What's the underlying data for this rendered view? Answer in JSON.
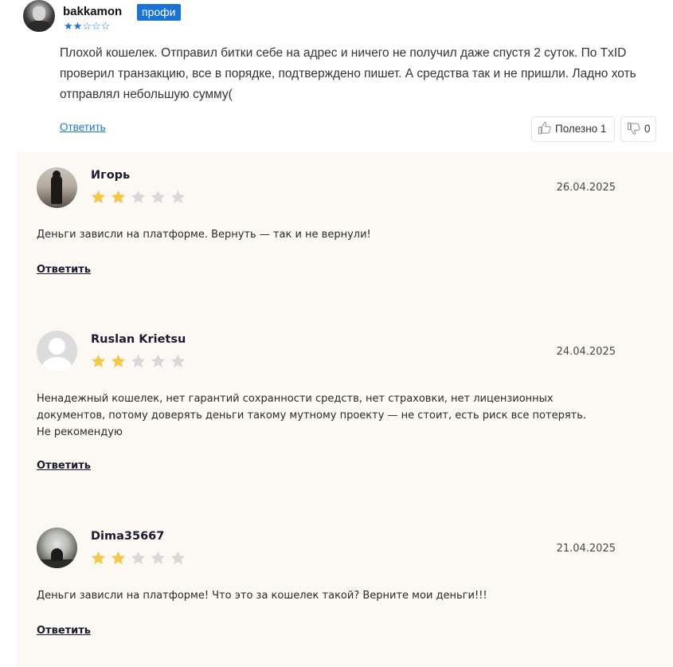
{
  "top_review": {
    "username": "bakkamon",
    "badge": "профи",
    "stars_filled": 2,
    "stars_total": 5,
    "text": "Плохой кошелек. Отправил битки себе на адрес и ничего не получил даже спустя 2 суток. По TxID проверил транзакцию, все в порядке, подтверждено пишет. А средства так и не пришли. Ладно хоть отправлял небольшую сумму(",
    "reply_label": "Ответить",
    "like_label": "Полезно 1",
    "dislike_count": "0"
  },
  "reviews": [
    {
      "name": "Игорь",
      "date": "26.04.2025",
      "rating": 2,
      "text": "Деньги зависли на платформе. Вернуть — так и не вернули!",
      "reply_label": "Ответить"
    },
    {
      "name": "Ruslan Krietsu",
      "date": "24.04.2025",
      "rating": 2,
      "text": "Ненадежный кошелек, нет гарантий сохранности средств, нет страховки, нет лицензионных документов, потому доверять деньги такому мутному проекту — не стоит, есть риск все потерять. Не рекомендую",
      "reply_label": "Ответить"
    },
    {
      "name": "Dima35667",
      "date": "21.04.2025",
      "rating": 2,
      "text": "Деньги зависли на платформе! Что это за кошелек такой? Верните мои деньги!!!",
      "reply_label": "Ответить"
    }
  ],
  "colors": {
    "accent_blue": "#1a73d8",
    "star_filled": "#f5c84c",
    "star_empty": "#d8d8d8",
    "panel_bg": "#fcf9f5"
  }
}
